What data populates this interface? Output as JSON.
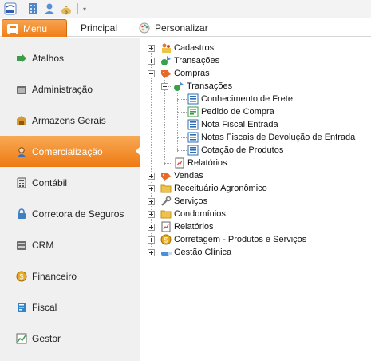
{
  "quick_access": {
    "icons": [
      "app-logo-icon",
      "building-icon",
      "user-icon",
      "money-bag-icon"
    ],
    "customize_glyph": "▾"
  },
  "ribbon": {
    "menu_tab": "Menu",
    "tabs": [
      "Principal",
      "Personalizar"
    ],
    "accent_color": "#ef7f1a"
  },
  "nav": {
    "items": [
      {
        "label": "Atalhos",
        "icon": "shortcut-icon"
      },
      {
        "label": "Administração",
        "icon": "admin-icon"
      },
      {
        "label": "Armazens Gerais",
        "icon": "warehouse-icon"
      },
      {
        "label": "Comercialização",
        "icon": "commerce-icon",
        "active": true
      },
      {
        "label": "Contábil",
        "icon": "accounting-icon"
      },
      {
        "label": "Corretora de Seguros",
        "icon": "insurance-icon"
      },
      {
        "label": "CRM",
        "icon": "crm-icon"
      },
      {
        "label": "Financeiro",
        "icon": "finance-icon"
      },
      {
        "label": "Fiscal",
        "icon": "fiscal-icon"
      },
      {
        "label": "Gestor",
        "icon": "manager-icon"
      }
    ]
  },
  "tree": {
    "cadastros": "Cadastros",
    "transacoes": "Transações",
    "compras": "Compras",
    "compras_transacoes": "Transações",
    "conhecimento_frete": "Conhecimento de Frete",
    "pedido_compra": "Pedido de Compra",
    "nota_fiscal_entrada": "Nota Fiscal Entrada",
    "notas_devolucao": "Notas Fiscais de Devolução de  Entrada",
    "cotacao_produtos": "Cotação de Produtos",
    "compras_relatorios": "Relatórios",
    "vendas": "Vendas",
    "receituario": "Receituário Agronômico",
    "servicos": "Serviços",
    "condominios": "Condomínios",
    "relatorios": "Relatórios",
    "corretagem": "Corretagem - Produtos e Serviços",
    "gestao_clinica": "Gestão Clínica"
  }
}
